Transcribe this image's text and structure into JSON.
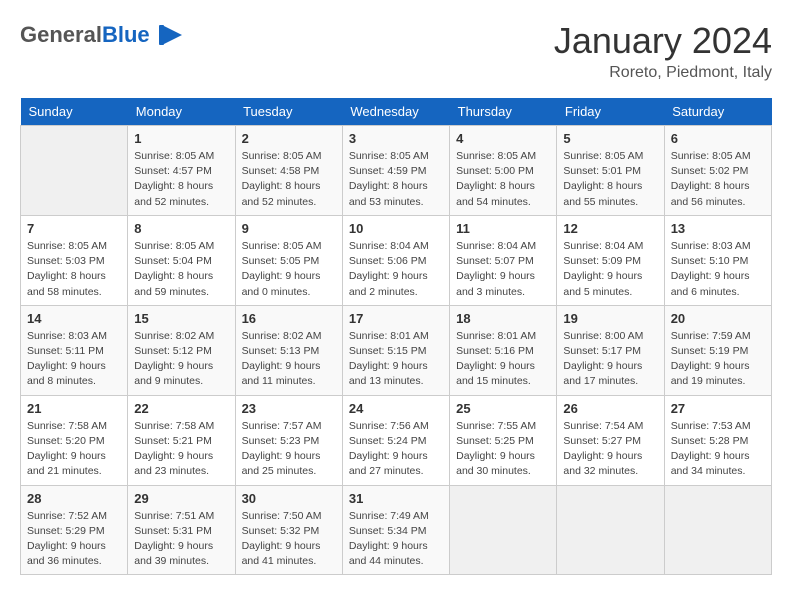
{
  "header": {
    "logo_general": "General",
    "logo_blue": "Blue",
    "month_title": "January 2024",
    "location": "Roreto, Piedmont, Italy"
  },
  "weekdays": [
    "Sunday",
    "Monday",
    "Tuesday",
    "Wednesday",
    "Thursday",
    "Friday",
    "Saturday"
  ],
  "weeks": [
    [
      {
        "day": "",
        "sunrise": "",
        "sunset": "",
        "daylight": ""
      },
      {
        "day": "1",
        "sunrise": "8:05 AM",
        "sunset": "4:57 PM",
        "daylight": "8 hours and 52 minutes."
      },
      {
        "day": "2",
        "sunrise": "8:05 AM",
        "sunset": "4:58 PM",
        "daylight": "8 hours and 52 minutes."
      },
      {
        "day": "3",
        "sunrise": "8:05 AM",
        "sunset": "4:59 PM",
        "daylight": "8 hours and 53 minutes."
      },
      {
        "day": "4",
        "sunrise": "8:05 AM",
        "sunset": "5:00 PM",
        "daylight": "8 hours and 54 minutes."
      },
      {
        "day": "5",
        "sunrise": "8:05 AM",
        "sunset": "5:01 PM",
        "daylight": "8 hours and 55 minutes."
      },
      {
        "day": "6",
        "sunrise": "8:05 AM",
        "sunset": "5:02 PM",
        "daylight": "8 hours and 56 minutes."
      }
    ],
    [
      {
        "day": "7",
        "sunrise": "8:05 AM",
        "sunset": "5:03 PM",
        "daylight": "8 hours and 58 minutes."
      },
      {
        "day": "8",
        "sunrise": "8:05 AM",
        "sunset": "5:04 PM",
        "daylight": "8 hours and 59 minutes."
      },
      {
        "day": "9",
        "sunrise": "8:05 AM",
        "sunset": "5:05 PM",
        "daylight": "9 hours and 0 minutes."
      },
      {
        "day": "10",
        "sunrise": "8:04 AM",
        "sunset": "5:06 PM",
        "daylight": "9 hours and 2 minutes."
      },
      {
        "day": "11",
        "sunrise": "8:04 AM",
        "sunset": "5:07 PM",
        "daylight": "9 hours and 3 minutes."
      },
      {
        "day": "12",
        "sunrise": "8:04 AM",
        "sunset": "5:09 PM",
        "daylight": "9 hours and 5 minutes."
      },
      {
        "day": "13",
        "sunrise": "8:03 AM",
        "sunset": "5:10 PM",
        "daylight": "9 hours and 6 minutes."
      }
    ],
    [
      {
        "day": "14",
        "sunrise": "8:03 AM",
        "sunset": "5:11 PM",
        "daylight": "9 hours and 8 minutes."
      },
      {
        "day": "15",
        "sunrise": "8:02 AM",
        "sunset": "5:12 PM",
        "daylight": "9 hours and 9 minutes."
      },
      {
        "day": "16",
        "sunrise": "8:02 AM",
        "sunset": "5:13 PM",
        "daylight": "9 hours and 11 minutes."
      },
      {
        "day": "17",
        "sunrise": "8:01 AM",
        "sunset": "5:15 PM",
        "daylight": "9 hours and 13 minutes."
      },
      {
        "day": "18",
        "sunrise": "8:01 AM",
        "sunset": "5:16 PM",
        "daylight": "9 hours and 15 minutes."
      },
      {
        "day": "19",
        "sunrise": "8:00 AM",
        "sunset": "5:17 PM",
        "daylight": "9 hours and 17 minutes."
      },
      {
        "day": "20",
        "sunrise": "7:59 AM",
        "sunset": "5:19 PM",
        "daylight": "9 hours and 19 minutes."
      }
    ],
    [
      {
        "day": "21",
        "sunrise": "7:58 AM",
        "sunset": "5:20 PM",
        "daylight": "9 hours and 21 minutes."
      },
      {
        "day": "22",
        "sunrise": "7:58 AM",
        "sunset": "5:21 PM",
        "daylight": "9 hours and 23 minutes."
      },
      {
        "day": "23",
        "sunrise": "7:57 AM",
        "sunset": "5:23 PM",
        "daylight": "9 hours and 25 minutes."
      },
      {
        "day": "24",
        "sunrise": "7:56 AM",
        "sunset": "5:24 PM",
        "daylight": "9 hours and 27 minutes."
      },
      {
        "day": "25",
        "sunrise": "7:55 AM",
        "sunset": "5:25 PM",
        "daylight": "9 hours and 30 minutes."
      },
      {
        "day": "26",
        "sunrise": "7:54 AM",
        "sunset": "5:27 PM",
        "daylight": "9 hours and 32 minutes."
      },
      {
        "day": "27",
        "sunrise": "7:53 AM",
        "sunset": "5:28 PM",
        "daylight": "9 hours and 34 minutes."
      }
    ],
    [
      {
        "day": "28",
        "sunrise": "7:52 AM",
        "sunset": "5:29 PM",
        "daylight": "9 hours and 36 minutes."
      },
      {
        "day": "29",
        "sunrise": "7:51 AM",
        "sunset": "5:31 PM",
        "daylight": "9 hours and 39 minutes."
      },
      {
        "day": "30",
        "sunrise": "7:50 AM",
        "sunset": "5:32 PM",
        "daylight": "9 hours and 41 minutes."
      },
      {
        "day": "31",
        "sunrise": "7:49 AM",
        "sunset": "5:34 PM",
        "daylight": "9 hours and 44 minutes."
      },
      {
        "day": "",
        "sunrise": "",
        "sunset": "",
        "daylight": ""
      },
      {
        "day": "",
        "sunrise": "",
        "sunset": "",
        "daylight": ""
      },
      {
        "day": "",
        "sunrise": "",
        "sunset": "",
        "daylight": ""
      }
    ]
  ],
  "labels": {
    "sunrise_prefix": "Sunrise: ",
    "sunset_prefix": "Sunset: ",
    "daylight_prefix": "Daylight: "
  }
}
